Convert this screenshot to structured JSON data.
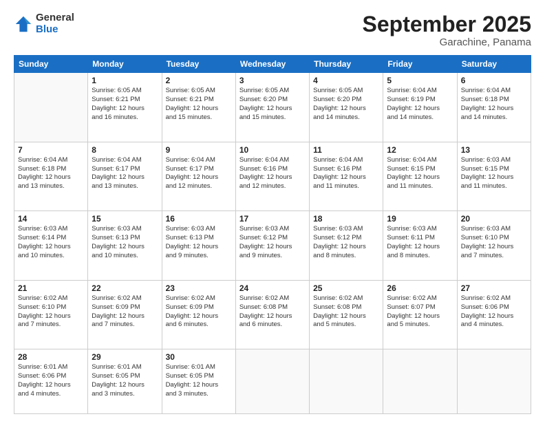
{
  "header": {
    "logo_general": "General",
    "logo_blue": "Blue",
    "month": "September 2025",
    "location": "Garachine, Panama"
  },
  "weekdays": [
    "Sunday",
    "Monday",
    "Tuesday",
    "Wednesday",
    "Thursday",
    "Friday",
    "Saturday"
  ],
  "weeks": [
    [
      {
        "day": "",
        "info": ""
      },
      {
        "day": "1",
        "info": "Sunrise: 6:05 AM\nSunset: 6:21 PM\nDaylight: 12 hours\nand 16 minutes."
      },
      {
        "day": "2",
        "info": "Sunrise: 6:05 AM\nSunset: 6:21 PM\nDaylight: 12 hours\nand 15 minutes."
      },
      {
        "day": "3",
        "info": "Sunrise: 6:05 AM\nSunset: 6:20 PM\nDaylight: 12 hours\nand 15 minutes."
      },
      {
        "day": "4",
        "info": "Sunrise: 6:05 AM\nSunset: 6:20 PM\nDaylight: 12 hours\nand 14 minutes."
      },
      {
        "day": "5",
        "info": "Sunrise: 6:04 AM\nSunset: 6:19 PM\nDaylight: 12 hours\nand 14 minutes."
      },
      {
        "day": "6",
        "info": "Sunrise: 6:04 AM\nSunset: 6:18 PM\nDaylight: 12 hours\nand 14 minutes."
      }
    ],
    [
      {
        "day": "7",
        "info": "Sunrise: 6:04 AM\nSunset: 6:18 PM\nDaylight: 12 hours\nand 13 minutes."
      },
      {
        "day": "8",
        "info": "Sunrise: 6:04 AM\nSunset: 6:17 PM\nDaylight: 12 hours\nand 13 minutes."
      },
      {
        "day": "9",
        "info": "Sunrise: 6:04 AM\nSunset: 6:17 PM\nDaylight: 12 hours\nand 12 minutes."
      },
      {
        "day": "10",
        "info": "Sunrise: 6:04 AM\nSunset: 6:16 PM\nDaylight: 12 hours\nand 12 minutes."
      },
      {
        "day": "11",
        "info": "Sunrise: 6:04 AM\nSunset: 6:16 PM\nDaylight: 12 hours\nand 11 minutes."
      },
      {
        "day": "12",
        "info": "Sunrise: 6:04 AM\nSunset: 6:15 PM\nDaylight: 12 hours\nand 11 minutes."
      },
      {
        "day": "13",
        "info": "Sunrise: 6:03 AM\nSunset: 6:15 PM\nDaylight: 12 hours\nand 11 minutes."
      }
    ],
    [
      {
        "day": "14",
        "info": "Sunrise: 6:03 AM\nSunset: 6:14 PM\nDaylight: 12 hours\nand 10 minutes."
      },
      {
        "day": "15",
        "info": "Sunrise: 6:03 AM\nSunset: 6:13 PM\nDaylight: 12 hours\nand 10 minutes."
      },
      {
        "day": "16",
        "info": "Sunrise: 6:03 AM\nSunset: 6:13 PM\nDaylight: 12 hours\nand 9 minutes."
      },
      {
        "day": "17",
        "info": "Sunrise: 6:03 AM\nSunset: 6:12 PM\nDaylight: 12 hours\nand 9 minutes."
      },
      {
        "day": "18",
        "info": "Sunrise: 6:03 AM\nSunset: 6:12 PM\nDaylight: 12 hours\nand 8 minutes."
      },
      {
        "day": "19",
        "info": "Sunrise: 6:03 AM\nSunset: 6:11 PM\nDaylight: 12 hours\nand 8 minutes."
      },
      {
        "day": "20",
        "info": "Sunrise: 6:03 AM\nSunset: 6:10 PM\nDaylight: 12 hours\nand 7 minutes."
      }
    ],
    [
      {
        "day": "21",
        "info": "Sunrise: 6:02 AM\nSunset: 6:10 PM\nDaylight: 12 hours\nand 7 minutes."
      },
      {
        "day": "22",
        "info": "Sunrise: 6:02 AM\nSunset: 6:09 PM\nDaylight: 12 hours\nand 7 minutes."
      },
      {
        "day": "23",
        "info": "Sunrise: 6:02 AM\nSunset: 6:09 PM\nDaylight: 12 hours\nand 6 minutes."
      },
      {
        "day": "24",
        "info": "Sunrise: 6:02 AM\nSunset: 6:08 PM\nDaylight: 12 hours\nand 6 minutes."
      },
      {
        "day": "25",
        "info": "Sunrise: 6:02 AM\nSunset: 6:08 PM\nDaylight: 12 hours\nand 5 minutes."
      },
      {
        "day": "26",
        "info": "Sunrise: 6:02 AM\nSunset: 6:07 PM\nDaylight: 12 hours\nand 5 minutes."
      },
      {
        "day": "27",
        "info": "Sunrise: 6:02 AM\nSunset: 6:06 PM\nDaylight: 12 hours\nand 4 minutes."
      }
    ],
    [
      {
        "day": "28",
        "info": "Sunrise: 6:01 AM\nSunset: 6:06 PM\nDaylight: 12 hours\nand 4 minutes."
      },
      {
        "day": "29",
        "info": "Sunrise: 6:01 AM\nSunset: 6:05 PM\nDaylight: 12 hours\nand 3 minutes."
      },
      {
        "day": "30",
        "info": "Sunrise: 6:01 AM\nSunset: 6:05 PM\nDaylight: 12 hours\nand 3 minutes."
      },
      {
        "day": "",
        "info": ""
      },
      {
        "day": "",
        "info": ""
      },
      {
        "day": "",
        "info": ""
      },
      {
        "day": "",
        "info": ""
      }
    ]
  ]
}
